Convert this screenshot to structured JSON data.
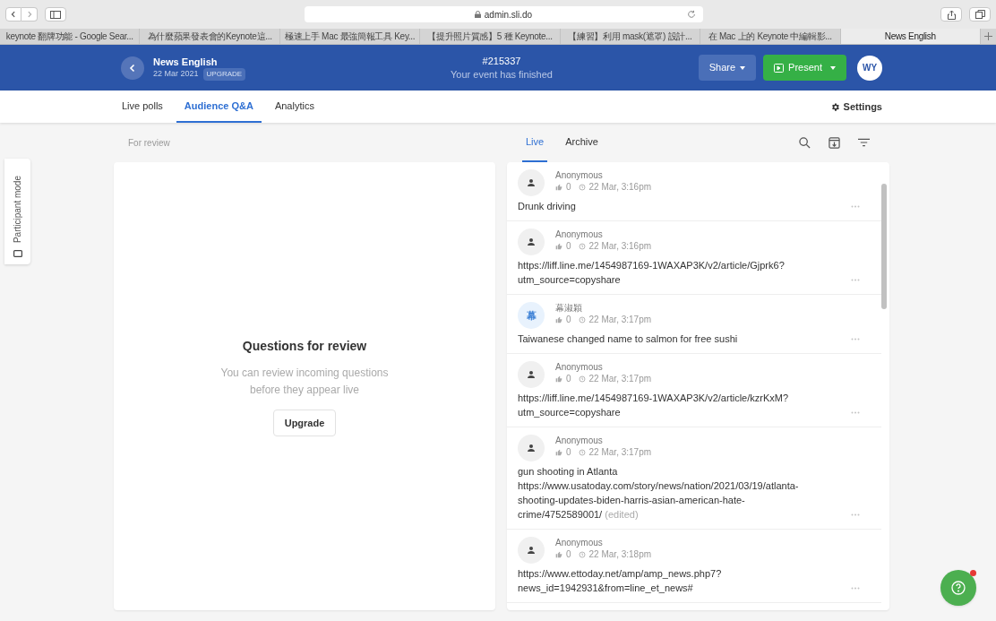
{
  "browser": {
    "url": "admin.sli.do",
    "tabs": [
      {
        "label": "keynote 翻牌功能 - Google Sear...",
        "selected": false
      },
      {
        "label": "為什麼蘋果發表會的Keynote這...",
        "selected": false
      },
      {
        "label": "極速上手 Mac 最強簡報工具 Key...",
        "selected": false
      },
      {
        "label": "【提升照片質感】5 種 Keynote...",
        "selected": false
      },
      {
        "label": "【練習】利用 mask(遮罩) 設計...",
        "selected": false
      },
      {
        "label": "在 Mac 上的 Keynote 中編輯影...",
        "selected": false
      },
      {
        "label": "News English",
        "selected": true
      }
    ]
  },
  "header": {
    "title": "News English",
    "date": "22 Mar 2021",
    "badge": "UPGRADE",
    "event_code": "#215337",
    "event_status": "Your event has finished",
    "share": "Share",
    "present": "Present",
    "avatar": "WY"
  },
  "nav_tabs": [
    {
      "label": "Live polls",
      "selected": false
    },
    {
      "label": "Audience Q&A",
      "selected": true
    },
    {
      "label": "Analytics",
      "selected": false
    }
  ],
  "settings": "Settings",
  "participant_mode": "Participant mode",
  "review_label": "For review",
  "feed_tabs": [
    {
      "label": "Live",
      "selected": true
    },
    {
      "label": "Archive",
      "selected": false
    }
  ],
  "review_panel": {
    "title": "Questions for review",
    "description": "You can review incoming questions before they appear live",
    "button": "Upgrade"
  },
  "questions": [
    {
      "author": "Anonymous",
      "kind": "anonymous",
      "likes": "0",
      "time": "22 Mar, 3:16pm",
      "text": "Drunk driving"
    },
    {
      "author": "Anonymous",
      "kind": "anonymous",
      "likes": "0",
      "time": "22 Mar, 3:16pm",
      "text": "https://liff.line.me/1454987169-1WAXAP3K/v2/article/Gjprk6? utm_source=copyshare"
    },
    {
      "author": "幕淑穎",
      "kind": "named",
      "avatar_text": "幕",
      "likes": "0",
      "time": "22 Mar, 3:17pm",
      "text": "Taiwanese changed name to salmon for free sushi"
    },
    {
      "author": "Anonymous",
      "kind": "anonymous",
      "likes": "0",
      "time": "22 Mar, 3:17pm",
      "text": "https://liff.line.me/1454987169-1WAXAP3K/v2/article/kzrKxM? utm_source=copyshare"
    },
    {
      "author": "Anonymous",
      "kind": "anonymous",
      "likes": "0",
      "time": "22 Mar, 3:17pm",
      "text": "gun shooting in Atlanta https://www.usatoday.com/story/news/nation/2021/03/19/atlanta-shooting-updates-biden-harris-asian-american-hate-crime/4752589001/",
      "edited_note": "(edited)"
    },
    {
      "author": "Anonymous",
      "kind": "anonymous",
      "likes": "0",
      "time": "22 Mar, 3:18pm",
      "text": "https://www.ettoday.net/amp/amp_news.php7? news_id=1942931&from=line_et_news#"
    }
  ]
}
